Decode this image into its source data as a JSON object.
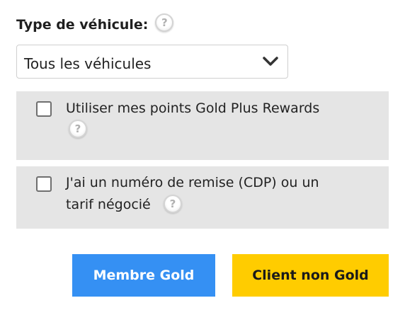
{
  "vehicle_type": {
    "label": "Type de véhicule:",
    "help_icon": "question-mark",
    "select_value": "Tous les véhicules",
    "select_icon": "chevron-down"
  },
  "options": [
    {
      "label": "Utiliser mes points Gold Plus Rewards",
      "checked": false,
      "help_icon": "question-mark"
    },
    {
      "label_line1": "J'ai un numéro de remise (CDP) ou un",
      "label_line2": "tarif négocié",
      "checked": false,
      "help_icon": "question-mark"
    }
  ],
  "buttons": {
    "member": "Membre Gold",
    "non_member": "Client non Gold"
  },
  "colors": {
    "member_button": "#3590f3",
    "non_member_button": "#ffcc00",
    "option_background": "#e5e5e5"
  },
  "help_glyph": "?"
}
